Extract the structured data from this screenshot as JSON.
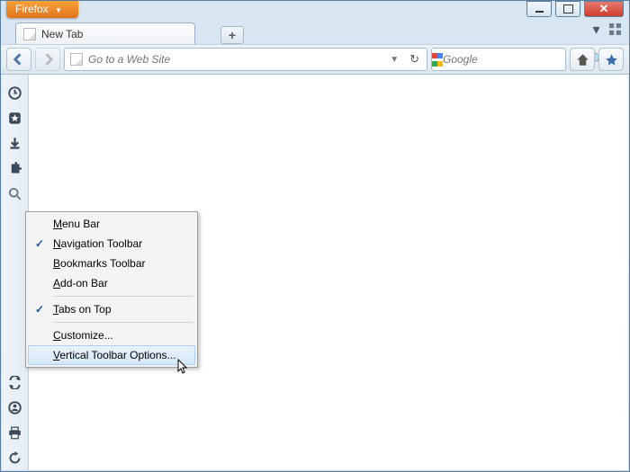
{
  "app": {
    "name": "Firefox"
  },
  "tab": {
    "title": "New Tab"
  },
  "urlbar": {
    "placeholder": "Go to a Web Site"
  },
  "search": {
    "placeholder": "Google"
  },
  "vtoolbar": {
    "top_icons": [
      "history",
      "bookmark-star",
      "download",
      "addon-puzzle",
      "search"
    ],
    "bottom_icons": [
      "sync",
      "identity",
      "print",
      "refresh"
    ]
  },
  "context_menu": {
    "items": [
      {
        "label": "Menu Bar",
        "accel_pos": 0,
        "checked": false
      },
      {
        "label": "Navigation Toolbar",
        "accel_pos": 0,
        "checked": true
      },
      {
        "label": "Bookmarks Toolbar",
        "accel_pos": 0,
        "checked": false
      },
      {
        "label": "Add-on Bar",
        "accel_pos": 0,
        "checked": false
      },
      {
        "sep": true
      },
      {
        "label": "Tabs on Top",
        "accel_pos": 0,
        "checked": true
      },
      {
        "sep": true
      },
      {
        "label": "Customize...",
        "accel_pos": 0,
        "checked": false
      },
      {
        "label": "Vertical Toolbar Options...",
        "accel_pos": 0,
        "checked": false,
        "hover": true
      }
    ]
  }
}
